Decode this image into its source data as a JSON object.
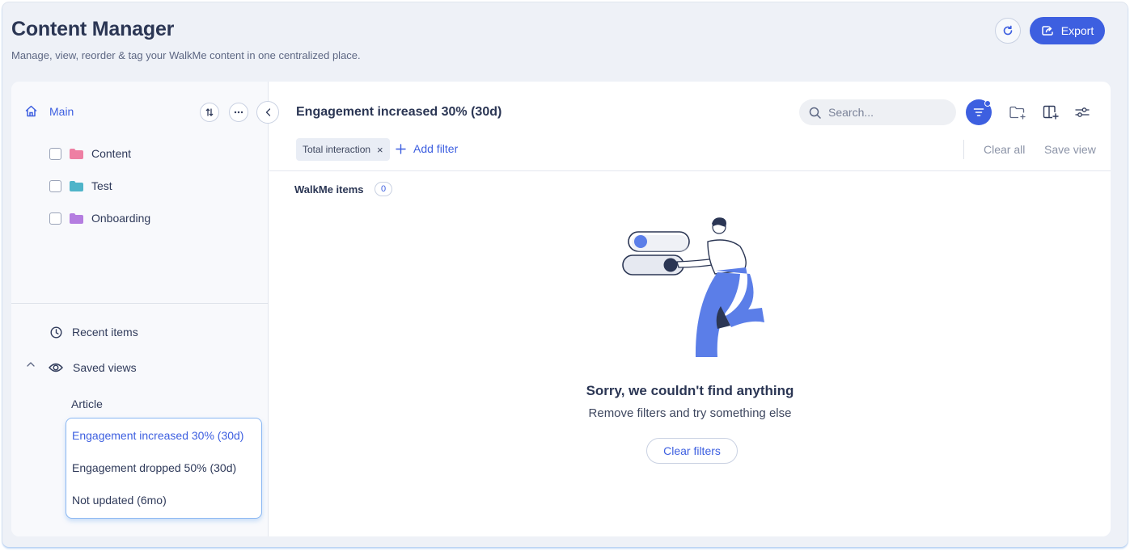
{
  "header": {
    "title": "Content Manager",
    "subtitle": "Manage, view, reorder & tag your WalkMe content in one centralized place.",
    "export_label": "Export"
  },
  "sidebar": {
    "root_label": "Main",
    "folders": [
      {
        "label": "Content",
        "color": "#ee7fa3"
      },
      {
        "label": "Test",
        "color": "#4fb4c9"
      },
      {
        "label": "Onboarding",
        "color": "#b47de0"
      }
    ],
    "recent_label": "Recent items",
    "saved_views_label": "Saved views",
    "saved_views": [
      {
        "label": "Article"
      },
      {
        "label": "Engagement increased 30% (30d)",
        "active": true
      },
      {
        "label": "Engagement dropped 50% (30d)"
      },
      {
        "label": "Not updated (6mo)"
      }
    ]
  },
  "content": {
    "view_title": "Engagement increased 30% (30d)",
    "search_placeholder": "Search...",
    "filter_chip": "Total interaction",
    "add_filter_label": "Add filter",
    "clear_all_label": "Clear all",
    "save_view_label": "Save view",
    "items_label": "WalkMe items",
    "items_count": "0",
    "empty_title": "Sorry, we couldn't find anything",
    "empty_subtitle": "Remove filters and try something else",
    "clear_filters_label": "Clear filters"
  },
  "colors": {
    "accent": "#3d5fe0",
    "background": "#eef1f7",
    "illustration_blue": "#5b7ee8"
  }
}
